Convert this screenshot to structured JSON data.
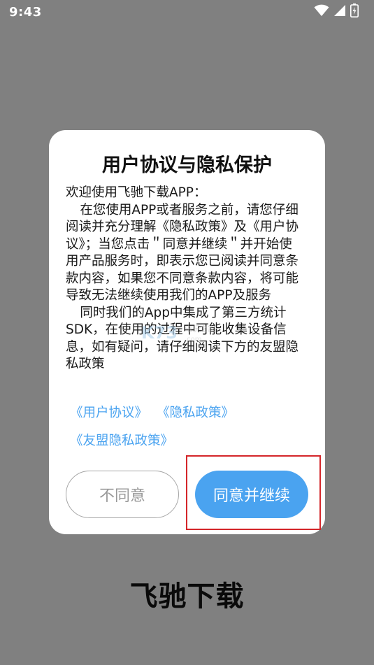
{
  "status_bar": {
    "time": "9:43",
    "icons": [
      "wifi-icon",
      "signal-icon",
      "battery-icon"
    ]
  },
  "dialog": {
    "title": "用户协议与隐私保护",
    "body": {
      "greeting": "欢迎使用飞驰下载APP：",
      "paragraph1": "在您使用APP或者服务之前，请您仔细阅读并充分理解《隐私政策》及《用户协议》；当您点击＂同意并继续＂并开始使用产品服务时，即表示您已阅读并同意条款内容，如果您不同意条款内容，将可能导致无法继续使用我们的APP及服务",
      "paragraph2": "同时我们的App中集成了第三方统计SDK，在使用的过程中可能收集设备信息，如有疑问，请仔细阅读下方的友盟隐私政策"
    },
    "links": {
      "user_agreement": "《用户协议》",
      "privacy_policy": "《隐私政策》",
      "umeng_privacy": "《友盟隐私政策》"
    },
    "buttons": {
      "disagree": "不同意",
      "agree": "同意并继续"
    }
  },
  "footer": {
    "app_name": "飞驰下载"
  },
  "colors": {
    "accent": "#4aa3f0",
    "overlay": "#808080",
    "highlight": "#d4262a"
  }
}
